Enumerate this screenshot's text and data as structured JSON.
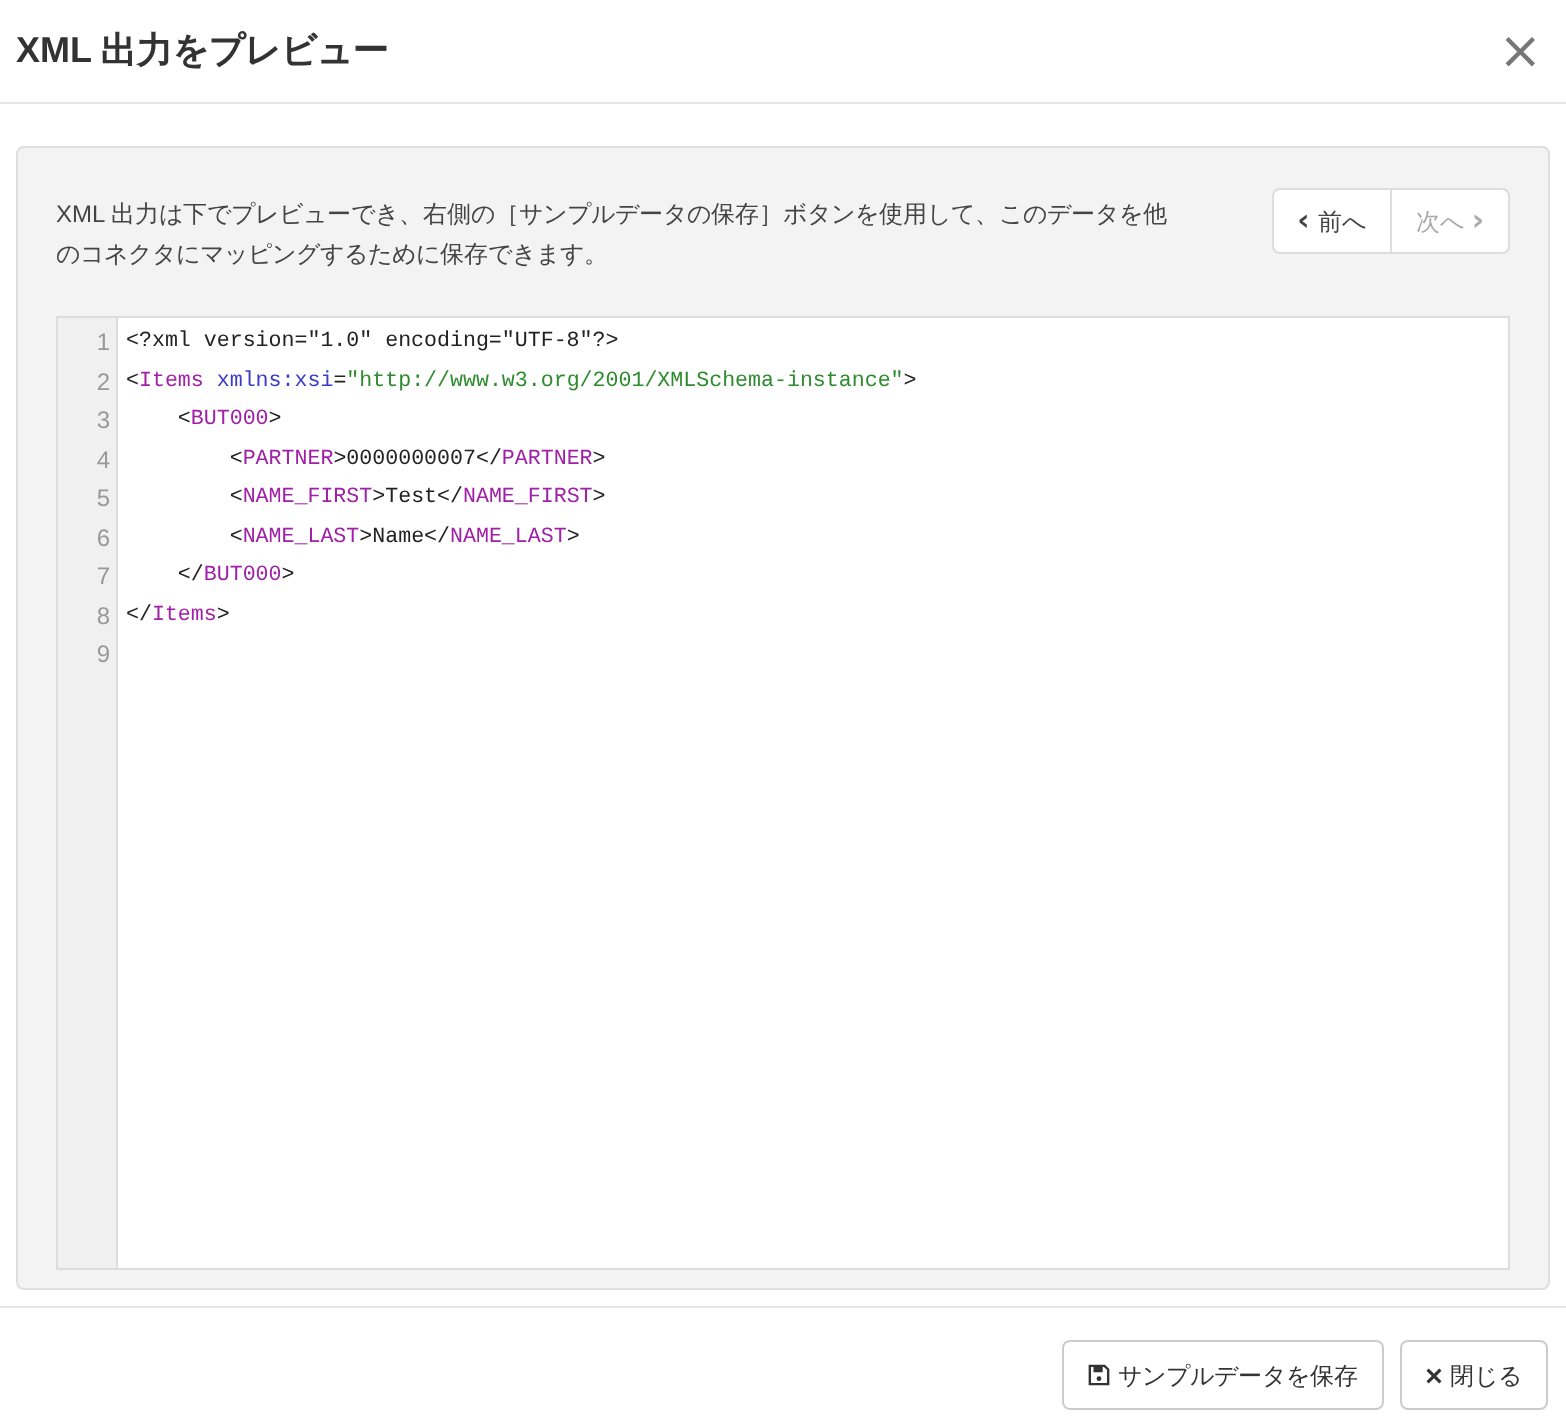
{
  "dialog": {
    "title": "XML 出力をプレビュー",
    "close": "×"
  },
  "description": "XML 出力は下でプレビューでき、右側の［サンプルデータの保存］ボタンを使用して、このデータを他のコネクタにマッピングするために保存できます。",
  "nav": [
    {
      "label": "前へ",
      "icon": "‹",
      "kind": "prev",
      "disabled": false
    },
    {
      "label": "次へ",
      "icon": "›",
      "kind": "next",
      "disabled": true
    }
  ],
  "editor": {
    "lines": [
      {
        "number": "1",
        "tokens": [
          {
            "kind": "punct",
            "text": "<?xml version=\"1.0\" encoding=\"UTF-8\"?>"
          }
        ]
      },
      {
        "number": "2",
        "tokens": [
          {
            "kind": "punct",
            "text": "<"
          },
          {
            "kind": "tag",
            "text": "Items"
          },
          {
            "kind": "attr",
            "text": " xmlns:xsi"
          },
          {
            "kind": "punct",
            "text": "="
          },
          {
            "kind": "string",
            "text": "\"http://www.w3.org/2001/XMLSchema-instance\""
          },
          {
            "kind": "punct",
            "text": ">"
          }
        ]
      },
      {
        "number": "3",
        "tokens": [
          {
            "kind": "punct",
            "text": "    <"
          },
          {
            "kind": "tag",
            "text": "BUT000"
          },
          {
            "kind": "punct",
            "text": ">"
          }
        ]
      },
      {
        "number": "4",
        "tokens": [
          {
            "kind": "punct",
            "text": "        <"
          },
          {
            "kind": "tag",
            "text": "PARTNER"
          },
          {
            "kind": "punct",
            "text": ">0000000007</"
          },
          {
            "kind": "tag",
            "text": "PARTNER"
          },
          {
            "kind": "punct",
            "text": ">"
          }
        ]
      },
      {
        "number": "5",
        "tokens": [
          {
            "kind": "punct",
            "text": "        <"
          },
          {
            "kind": "tag",
            "text": "NAME_FIRST"
          },
          {
            "kind": "punct",
            "text": ">Test</"
          },
          {
            "kind": "tag",
            "text": "NAME_FIRST"
          },
          {
            "kind": "punct",
            "text": ">"
          }
        ]
      },
      {
        "number": "6",
        "tokens": [
          {
            "kind": "punct",
            "text": "        <"
          },
          {
            "kind": "tag",
            "text": "NAME_LAST"
          },
          {
            "kind": "punct",
            "text": ">Name</"
          },
          {
            "kind": "tag",
            "text": "NAME_LAST"
          },
          {
            "kind": "punct",
            "text": ">"
          }
        ]
      },
      {
        "number": "7",
        "tokens": [
          {
            "kind": "punct",
            "text": "    </"
          },
          {
            "kind": "tag",
            "text": "BUT000"
          },
          {
            "kind": "punct",
            "text": ">"
          }
        ]
      },
      {
        "number": "8",
        "tokens": [
          {
            "kind": "punct",
            "text": "</"
          },
          {
            "kind": "tag",
            "text": "Items"
          },
          {
            "kind": "punct",
            "text": ">"
          }
        ]
      },
      {
        "number": "9"
      }
    ]
  },
  "footer_buttons": [
    {
      "label": "サンプルデータを保存",
      "kind": "save"
    },
    {
      "label": "閉じる",
      "kind": "close"
    }
  ]
}
